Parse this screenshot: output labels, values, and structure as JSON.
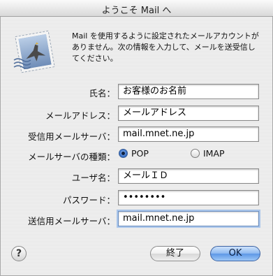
{
  "window": {
    "title": "ようこそ Mail へ"
  },
  "intro": {
    "text": "Mail を使用するように設定されたメールアカウントがありません。次の情報を入力して、メールを送受信してください。"
  },
  "form": {
    "name_label": "氏名：",
    "name_value": "お客様のお名前",
    "email_label": "メールアドレス：",
    "email_value": "メールアドレス",
    "incoming_label": "受信用メールサーバ：",
    "incoming_value": "mail.mnet.ne.jp",
    "server_type_label": "メールサーバの種類：",
    "server_type_options": [
      "POP",
      "IMAP"
    ],
    "server_type_selected": "POP",
    "user_label": "ユーザ名：",
    "user_value": "メールＩＤ",
    "password_label": "パスワード：",
    "password_value": "••••••••",
    "outgoing_label": "送信用メールサーバ：",
    "outgoing_value": "mail.mnet.ne.jp"
  },
  "buttons": {
    "help": "?",
    "cancel": "終了",
    "ok": "OK"
  },
  "icons": {
    "app": "mail-stamp-icon",
    "help": "help-icon"
  }
}
